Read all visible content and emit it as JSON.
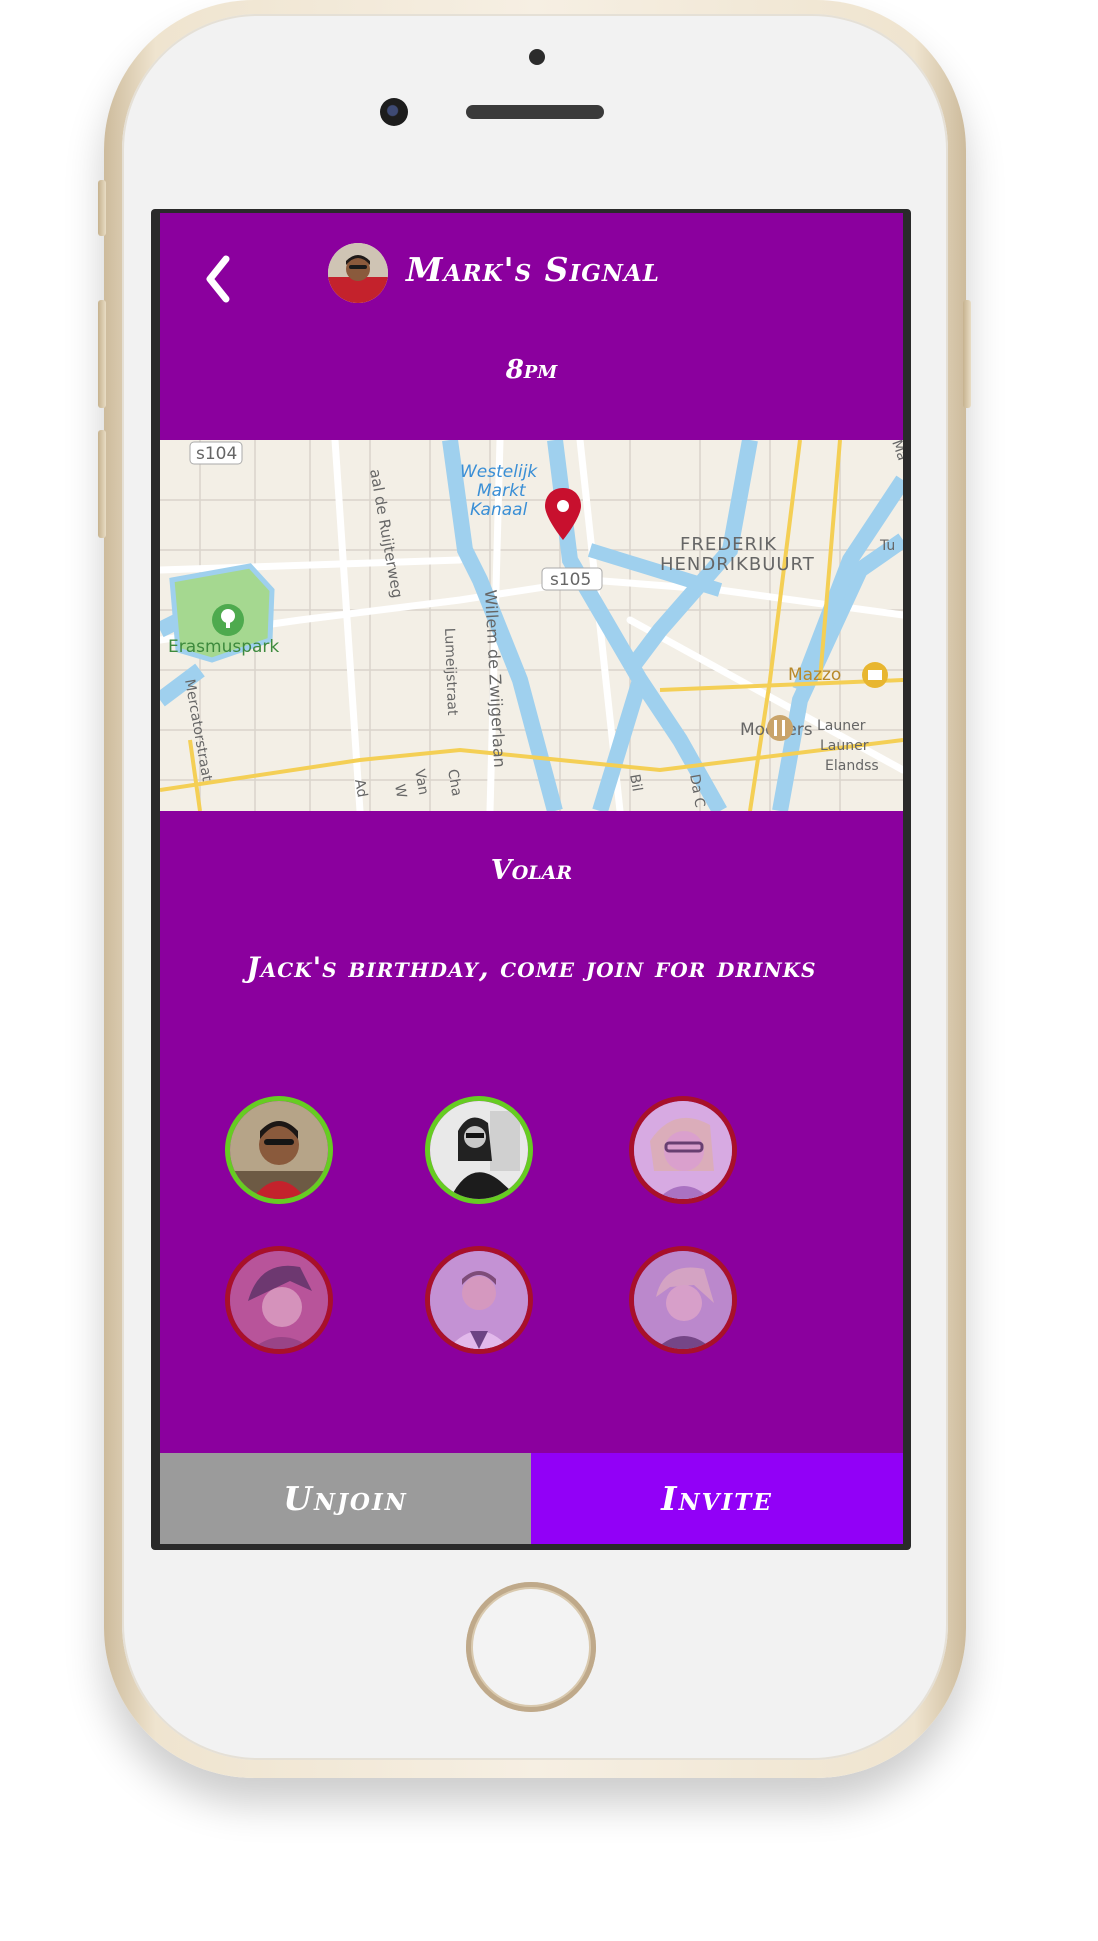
{
  "header": {
    "title": "Mark's Signal",
    "time": "8pm"
  },
  "event": {
    "venue": "Volar",
    "description": "Jack's birthday, come join for drinks"
  },
  "map": {
    "labels": {
      "s104": "s104",
      "s105": "s105",
      "westelijk1": "Westelijk",
      "westelijk2": "Markt",
      "westelijk3": "Kanaal",
      "frederik1": "FREDERIK",
      "frederik2": "HENDRIKBUURT",
      "erasmuspark": "Erasmuspark",
      "mazzo": "Mazzo",
      "moeders": "Moeders",
      "ruijterweg": "aal de Ruijterweg",
      "zwijger": "Willem de Zwijgerlaan",
      "lumeij": "Lumeijstraat",
      "mercator": "Mercatorstraat",
      "launer1": "Launer",
      "launer2": "Launer",
      "elandss": "Elandss",
      "tu": "Tu",
      "ma": "Ma",
      "bil": "Bil",
      "dac": "Da C",
      "van": "Van",
      "cha": "Cha",
      "ad": "Ad",
      "w": "W"
    }
  },
  "attendees_status": [
    "going",
    "going",
    "not-going",
    "not-going",
    "not-going",
    "not-going"
  ],
  "buttons": {
    "unjoin": "Unjoin",
    "invite": "Invite"
  },
  "colors": {
    "background": "#8b009e",
    "invite": "#9200f7",
    "unjoin": "#9b9b9b",
    "going_ring": "#66cc22",
    "not_going_ring": "#a8102a",
    "map_pin": "#c8102e"
  }
}
